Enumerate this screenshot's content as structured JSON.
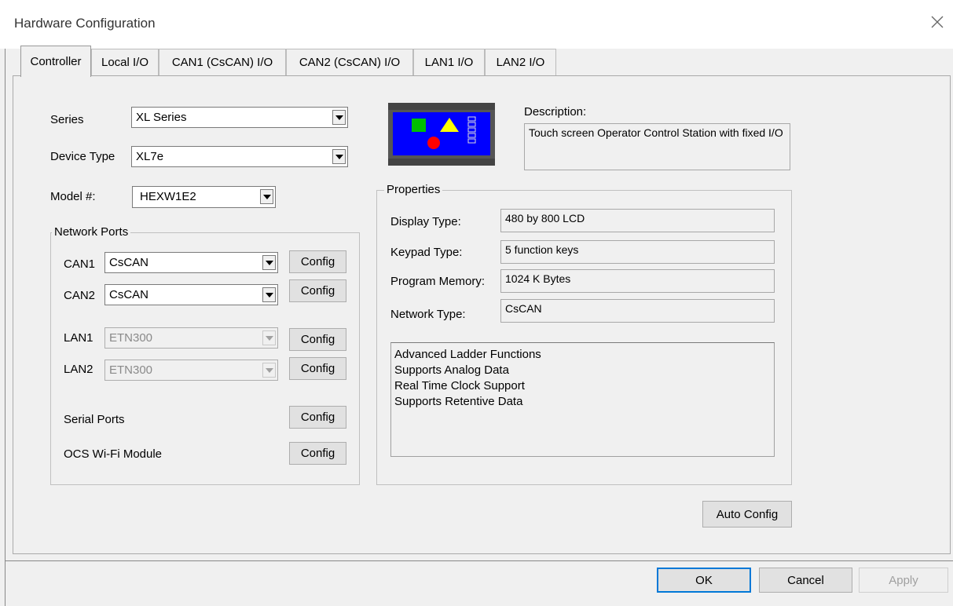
{
  "window": {
    "title": "Hardware Configuration"
  },
  "tabs": [
    {
      "label": "Controller",
      "active": true
    },
    {
      "label": "Local I/O"
    },
    {
      "label": "CAN1 (CsCAN) I/O"
    },
    {
      "label": "CAN2 (CsCAN) I/O"
    },
    {
      "label": "LAN1 I/O"
    },
    {
      "label": "LAN2 I/O"
    }
  ],
  "controller": {
    "series_label": "Series",
    "series_value": "XL Series",
    "device_type_label": "Device Type",
    "device_type_value": "XL7e",
    "model_label": "Model #:",
    "model_value": "HEXW1E2"
  },
  "network_ports": {
    "legend": "Network Ports",
    "can1": {
      "label": "CAN1",
      "value": "CsCAN",
      "button": "Config"
    },
    "can2": {
      "label": "CAN2",
      "value": "CsCAN",
      "button": "Config"
    },
    "lan1": {
      "label": "LAN1",
      "value": "ETN300",
      "button": "Config"
    },
    "lan2": {
      "label": "LAN2",
      "value": "ETN300",
      "button": "Config"
    },
    "serial": {
      "label": "Serial Ports",
      "button": "Config"
    },
    "wifi": {
      "label": "OCS Wi-Fi Module",
      "button": "Config"
    }
  },
  "description": {
    "label": "Description:",
    "text": "Touch screen Operator Control Station with fixed I/O"
  },
  "properties": {
    "legend": "Properties",
    "display_type_label": "Display Type:",
    "display_type_value": "480 by 800 LCD",
    "keypad_type_label": "Keypad Type:",
    "keypad_type_value": "5 function keys",
    "program_memory_label": "Program Memory:",
    "program_memory_value": "1024 K Bytes",
    "network_type_label": "Network Type:",
    "network_type_value": "CsCAN",
    "features": [
      "Advanced Ladder Functions",
      "Supports Analog Data",
      "Real Time Clock Support",
      "Supports Retentive Data"
    ]
  },
  "buttons": {
    "auto_config": "Auto Config",
    "ok": "OK",
    "cancel": "Cancel",
    "apply": "Apply"
  },
  "colors": {
    "device_screen": "#0000ff",
    "device_square": "#00c000",
    "device_triangle": "#ffff00",
    "device_circle": "#ff0000",
    "focus_border": "#0078d7"
  },
  "icons": {
    "close": "close-icon",
    "dropdown": "chevron-down-icon",
    "device": "device-image"
  }
}
